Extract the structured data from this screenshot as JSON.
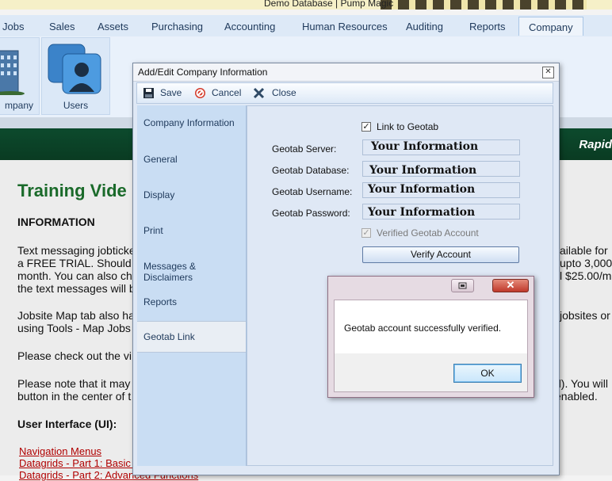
{
  "window": {
    "title": "Demo Database | Pump Magic"
  },
  "ribbon": {
    "tabs": [
      "Jobs",
      "Sales",
      "Assets",
      "Purchasing",
      "Accounting",
      "Human Resources",
      "Auditing",
      "Reports",
      "Company"
    ],
    "active_tab": "Company",
    "buttons": [
      {
        "label": "mpany",
        "icon": "building-icon"
      },
      {
        "label": "Users",
        "icon": "users-icon"
      }
    ]
  },
  "banner": {
    "text": "Rapid"
  },
  "background_page": {
    "heading": "Training Vide",
    "section": "INFORMATION",
    "para1_lines": [
      "Text messaging jobticke",
      "a FREE TRIAL. Should",
      "month. You can also ch",
      "the text messages will b"
    ],
    "para1_right": [
      "ailable for",
      "upto 3,000",
      "l $25.00/m"
    ],
    "para2_lines": [
      "Jobsite Map tab also ha",
      "using Tools - Map Jobs"
    ],
    "para2_right": "jobsites or",
    "para3": "Please check out the vi",
    "para4_lines": [
      "Please note that it may",
      "button in the center of t"
    ],
    "para4_right": [
      "d). You will",
      "enabled."
    ],
    "ui_heading": "User Interface (UI):",
    "links": [
      "Navigation Menus",
      "Datagrids - Part 1: Basic F",
      "Datagrids - Part 2: Advanced Functions"
    ]
  },
  "dialog": {
    "title": "Add/Edit Company Information",
    "toolbar": {
      "save": "Save",
      "cancel": "Cancel",
      "close": "Close"
    },
    "nav_items": [
      "Company Information",
      "General",
      "Display",
      "Print",
      "Messages & Disclaimers",
      "Reports",
      "Geotab Link"
    ],
    "selected_nav": "Geotab Link",
    "geotab": {
      "link_label": "Link to Geotab",
      "link_checked": true,
      "server_label": "Geotab Server:",
      "server_value": "Your Information",
      "database_label": "Geotab Database:",
      "database_value": "Your Information",
      "username_label": "Geotab Username:",
      "username_value": "Your Information",
      "password_label": "Geotab Password:",
      "password_value": "Your Information",
      "verified_label": "Verified Geotab Account",
      "verified_checked": true,
      "verify_button": "Verify Account"
    }
  },
  "message_box": {
    "text": "Geotab account successfully verified.",
    "ok_button": "OK"
  }
}
